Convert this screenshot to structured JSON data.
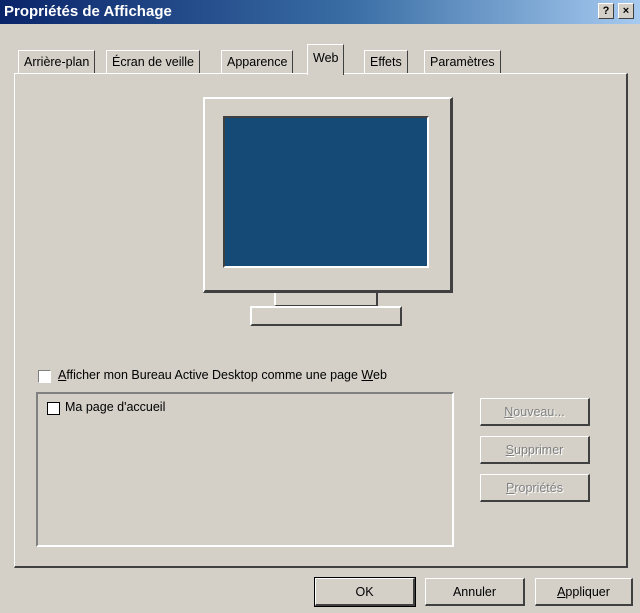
{
  "window": {
    "title": "Propriétés de Affichage",
    "help_btn": "?",
    "close_btn": "×"
  },
  "tabs": [
    {
      "label": "Arrière-plan"
    },
    {
      "label": "Écran de veille"
    },
    {
      "label": "Apparence"
    },
    {
      "label": "Web",
      "active": true
    },
    {
      "label": "Effets"
    },
    {
      "label": "Paramètres"
    }
  ],
  "web": {
    "active_desktop_checkbox": {
      "checked": false,
      "prefix": "A",
      "rest_before": "fficher mon Bureau Active Desktop comme une page ",
      "accel_end": "W",
      "end": "eb"
    },
    "list_items": [
      {
        "label": "Ma page d'accueil",
        "checked": false
      }
    ],
    "side_buttons": {
      "new": {
        "accel": "N",
        "rest": "ouveau..."
      },
      "delete": {
        "accel": "S",
        "rest": "upprimer"
      },
      "properties": {
        "accel": "P",
        "rest": "ropriétés"
      }
    }
  },
  "footer": {
    "ok": "OK",
    "cancel": "Annuler",
    "apply": {
      "accel": "A",
      "rest": "ppliquer"
    }
  },
  "colors": {
    "screen": "#154a76",
    "face": "#d4d0c8"
  }
}
